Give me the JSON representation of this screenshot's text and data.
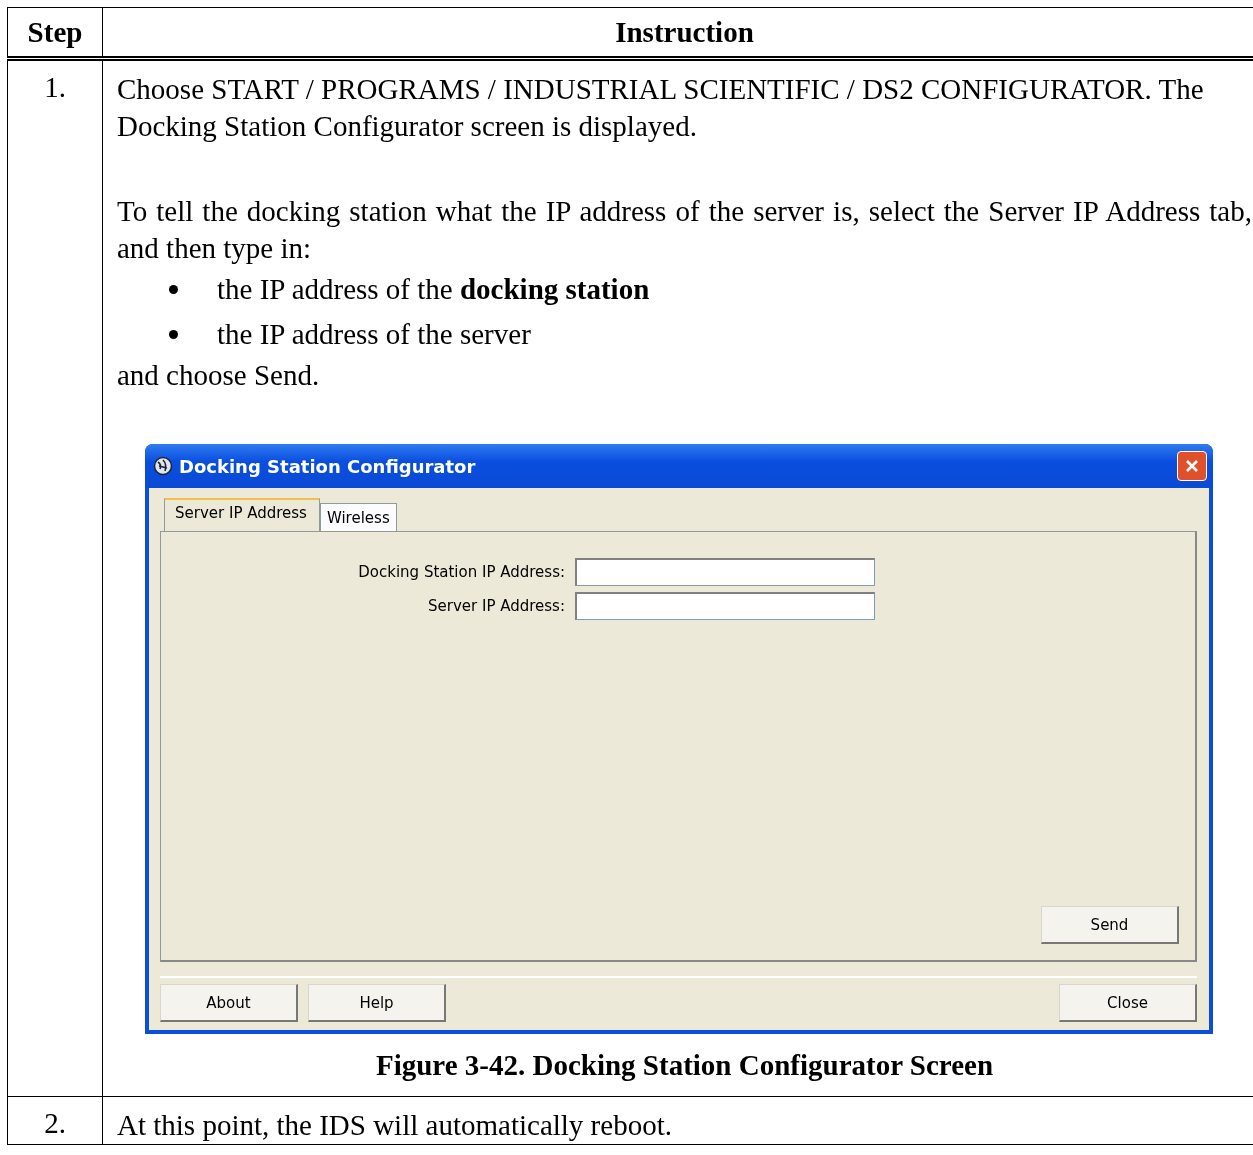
{
  "table": {
    "columns": [
      "Step",
      "Instruction"
    ],
    "rows": [
      {
        "step": "1.",
        "intro": "Choose START / PROGRAMS / INDUSTRIAL SCIENTIFIC / DS2 CONFIGURATOR.  The Docking Station Configurator screen is displayed.",
        "instruction": "To tell the docking station what the IP address of the server is, select the Server IP Address tab, and then type in:",
        "bullets": [
          "the IP address of the **docking station**",
          "the IP address of the server"
        ],
        "closing": "and choose Send.",
        "dialog": {
          "title": "Docking Station Configurator",
          "tabs": [
            {
              "label": "Server IP Address",
              "selected": true
            },
            {
              "label": "Wireless",
              "selected": false
            }
          ],
          "fields": [
            {
              "label": "Docking Station IP Address:"
            },
            {
              "label": "Server IP Address:"
            }
          ],
          "panel_button": "Send",
          "left_buttons": [
            "About",
            "Help"
          ],
          "right_button": "Close"
        },
        "caption": "Figure 3-42.  Docking Station Configurator Screen"
      },
      {
        "step": "2.",
        "intro": "At this point, the IDS will automatically reboot."
      }
    ]
  }
}
